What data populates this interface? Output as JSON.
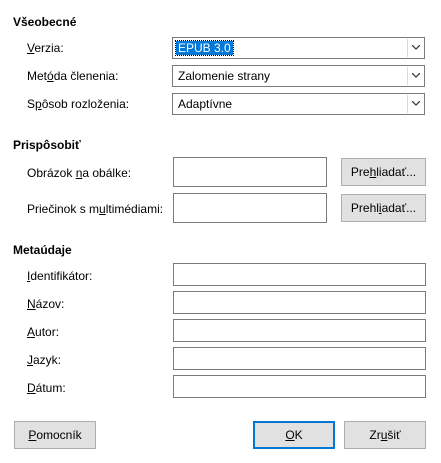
{
  "general": {
    "title": "Všeobecné",
    "version": {
      "label_u": "V",
      "label_rest": "erzia:",
      "value": "EPUB 3.0"
    },
    "split": {
      "label_pre": "Met",
      "label_u": "ó",
      "label_rest": "da členenia:",
      "value": "Zalomenie strany"
    },
    "layout": {
      "label_pre": "S",
      "label_u": "p",
      "label_rest": "ôsob rozloženia:",
      "value": "Adaptívne"
    }
  },
  "customize": {
    "title": "Prispôsobiť",
    "cover": {
      "label_pre": "Obrázok ",
      "label_u": "n",
      "label_rest": "a obálke:",
      "value": "",
      "browse_pre": "Pre",
      "browse_u": "h",
      "browse_rest": "liadať..."
    },
    "media": {
      "label_pre": "Priečinok s m",
      "label_u": "u",
      "label_rest": "ltimédiami:",
      "value": "",
      "browse_pre": "Prehl",
      "browse_u": "i",
      "browse_rest": "adať..."
    }
  },
  "metadata": {
    "title": "Metaúdaje",
    "identifier": {
      "label_u": "I",
      "label_rest": "dentifikátor:",
      "value": ""
    },
    "name": {
      "label_u": "N",
      "label_rest": "ázov:",
      "value": ""
    },
    "author": {
      "label_u": "A",
      "label_rest": "utor:",
      "value": ""
    },
    "language": {
      "label_u": "J",
      "label_rest": "azyk:",
      "value": ""
    },
    "date": {
      "label_u": "D",
      "label_rest": "átum:",
      "value": ""
    }
  },
  "buttons": {
    "help": {
      "label_u": "P",
      "label_rest": "omocník"
    },
    "ok": {
      "label_u": "O",
      "label_rest": "K"
    },
    "cancel": {
      "label_pre": "Zr",
      "label_u": "u",
      "label_rest": "šiť"
    }
  },
  "icons": {
    "dropdown": "chevron-down-icon"
  },
  "colors": {
    "selection": "#0078d7",
    "default_button_border": "#0078d7"
  }
}
